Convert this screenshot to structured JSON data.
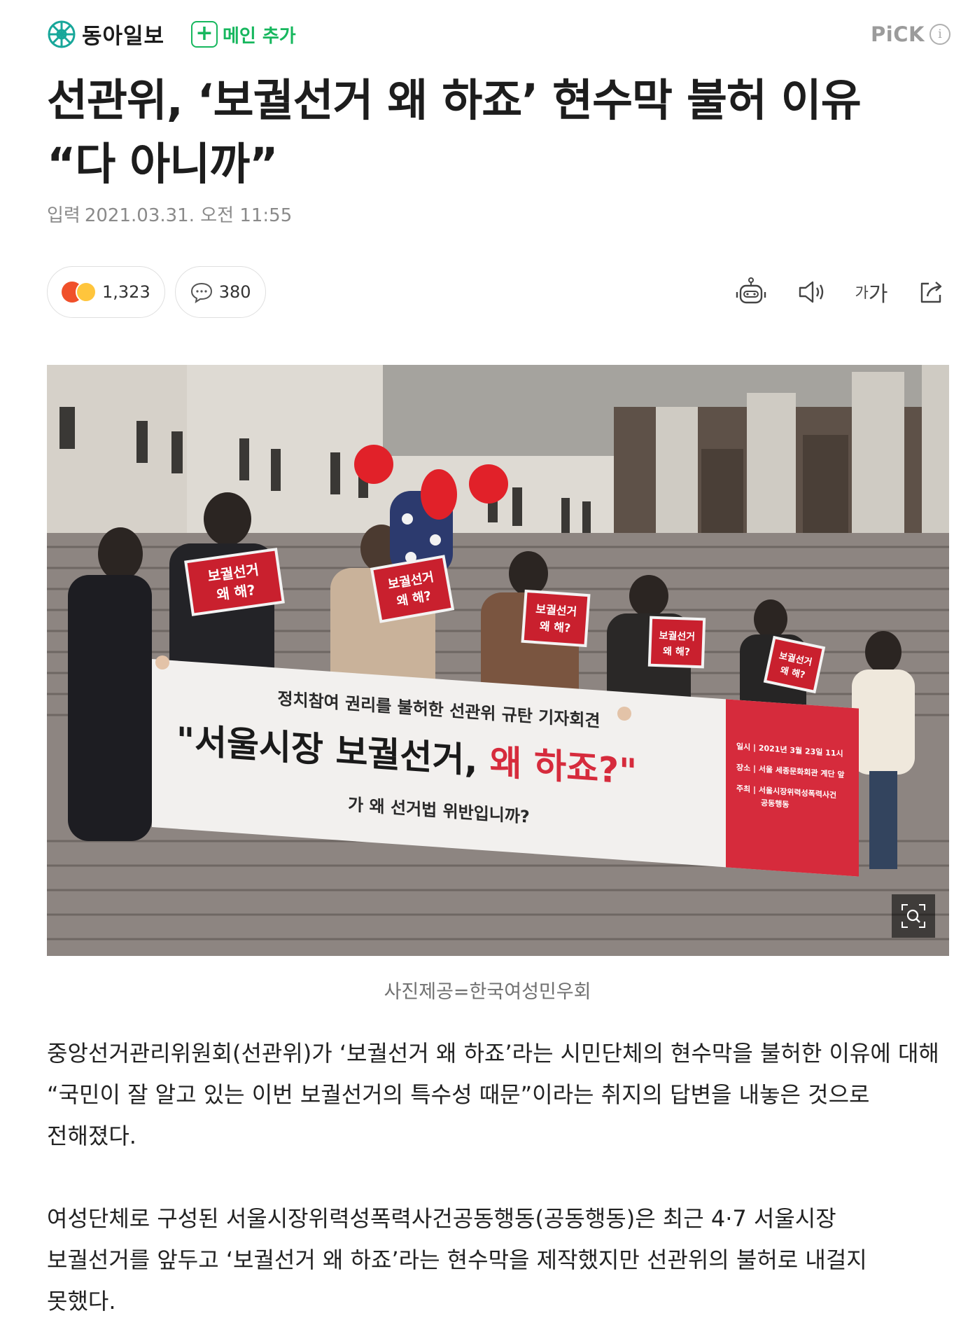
{
  "header": {
    "brand_name": "동아일보",
    "subscribe_icon": "+",
    "subscribe_label": "메인 추가",
    "pick_label": "PiCK",
    "pick_info_icon": "i"
  },
  "article": {
    "title": "선관위, ‘보궐선거 왜 하죠’ 현수막 불허 이유\n“다 아니까”",
    "date_label": "입력",
    "date_value": "2021.03.31. 오전 11:55",
    "reaction_count": "1,323",
    "comment_count": "380",
    "font_tool_label_small": "가",
    "font_tool_label_large": "가",
    "photo_caption": "사진제공=한국여성민우회",
    "paragraphs": [
      "중앙선거관리위원회(선관위)가 ‘보궐선거 왜 하죠’라는 시민단체의 현수막을 불허한 이유에 대해 “국민이 잘 알고 있는 이번 보궐선거의 특수성 때문”이라는 취지의 답변을 내놓은 것으로 전해졌다.",
      "여성단체로 구성된 서울시장위력성폭력사건공동행동(공동행동)은 최근 4·7 서울시장 보궐선거를 앞두고 ‘보궐선거 왜 하죠’라는 현수막을 제작했지만 선관위의 불허로 내걸지 못했다."
    ]
  },
  "photo": {
    "banner_top": "정치참여 권리를 불허한 선관위 규탄 기자회견",
    "banner_main": "\"서울시장 보궐선거, ",
    "banner_main_accent": "왜 하죠?\"",
    "banner_sub": "가 왜 선거법 위반입니까?",
    "banner_side_1": "일시 | 2021년 3월 23일 11시",
    "banner_side_2": "장소 | 서울 세종문화회관 계단 앞",
    "banner_side_3": "주최 | 서울시장위력성폭력사건",
    "banner_side_4": "공동행동",
    "sign_text_1": "보궐선거",
    "sign_text_2": "왜 해?"
  },
  "icons": {
    "brand": "dongA-logo-icon",
    "reaction": "angry-emoji-icon",
    "comment": "speech-bubble-icon",
    "tts_bot": "robot-icon",
    "audio": "speaker-icon",
    "share": "share-icon",
    "zoom": "zoom-icon"
  },
  "colors": {
    "brand_green": "#17b75e",
    "banner_red": "#d62b3c",
    "text": "#222222"
  }
}
